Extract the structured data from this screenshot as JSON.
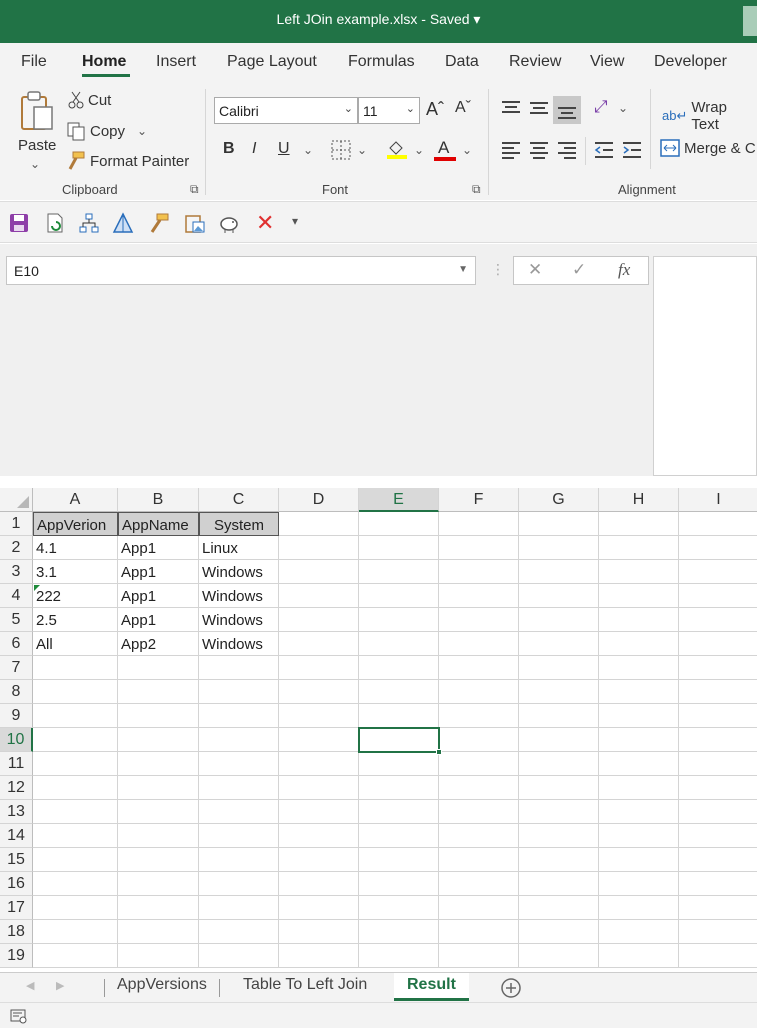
{
  "title": {
    "text": "Left JOin example.xlsx  -  Saved  ▾"
  },
  "menu": [
    "File",
    "Home",
    "Insert",
    "Page Layout",
    "Formulas",
    "Data",
    "Review",
    "View",
    "Developer"
  ],
  "ribbon": {
    "paste": "Paste",
    "cut": "Cut",
    "copy": "Copy",
    "format_painter": "Format Painter",
    "clipboard_group": "Clipboard",
    "font_name": "Calibri",
    "font_size": "11",
    "font_group": "Font",
    "bold": "B",
    "italic": "I",
    "underline": "U",
    "grow_font": "Aˆ",
    "shrink_font": "Aˇ",
    "font_color": "A",
    "wrap_text": "Wrap Text",
    "merge": "Merge & C",
    "alignment_group": "Alignment"
  },
  "formula_bar": {
    "name_box": "E10",
    "cancel": "✕",
    "enter": "✓",
    "fx": "fx"
  },
  "columns": [
    "A",
    "B",
    "C",
    "D",
    "E",
    "F",
    "G",
    "H",
    "I"
  ],
  "rows": [
    "1",
    "2",
    "3",
    "4",
    "5",
    "6",
    "7",
    "8",
    "9",
    "10",
    "11",
    "12",
    "13",
    "14",
    "15",
    "16",
    "17",
    "18",
    "19"
  ],
  "table": {
    "headers": [
      "AppVerion",
      "AppName",
      "System"
    ],
    "rows": [
      [
        "4.1",
        "App1",
        "Linux"
      ],
      [
        "3.1",
        "App1",
        "Windows"
      ],
      [
        "222",
        "App1",
        "Windows"
      ],
      [
        "2.5",
        "App1",
        "Windows"
      ],
      [
        "All",
        "App2",
        "Windows"
      ]
    ]
  },
  "selected_cell": "E10",
  "tabs": [
    "AppVersions",
    "Table To Left Join",
    "Result"
  ],
  "active_tab": "Result",
  "colors": {
    "accent": "#217346",
    "header_fill": "#d0d0d0"
  }
}
